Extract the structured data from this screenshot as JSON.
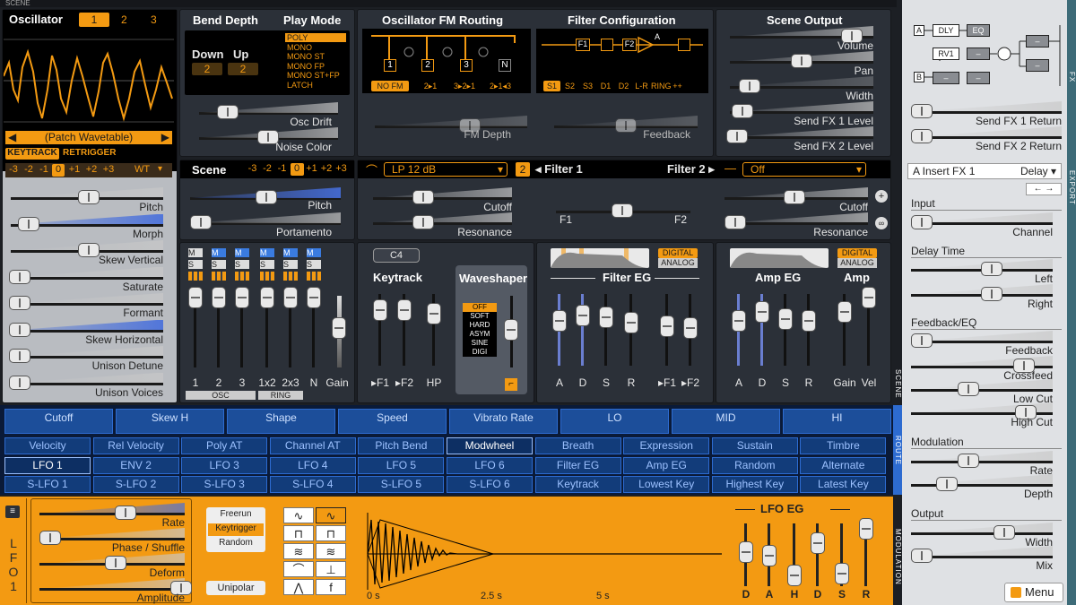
{
  "scene_tab": "SCENE",
  "osc": {
    "title": "Oscillator",
    "nums": [
      "1",
      "2",
      "3"
    ],
    "patch": "(Patch Wavetable)",
    "keytrack": "KEYTRACK",
    "retrigger": "RETRIGGER",
    "octaves": [
      "-3",
      "-2",
      "-1",
      "0",
      "+1",
      "+2",
      "+3"
    ],
    "wt": "WT",
    "sliders": [
      "Pitch",
      "Morph",
      "Skew Vertical",
      "Saturate",
      "Formant",
      "Skew Horizontal",
      "Unison Detune",
      "Unison Voices"
    ]
  },
  "bend": {
    "title": "Bend Depth",
    "down": "Down",
    "up": "Up",
    "down_val": "2",
    "up_val": "2",
    "osc_drift": "Osc Drift",
    "noise_color": "Noise Color"
  },
  "playmode": {
    "title": "Play Mode",
    "items": [
      "POLY",
      "MONO",
      "MONO ST",
      "MONO FP",
      "MONO ST+FP",
      "LATCH"
    ]
  },
  "fm": {
    "title": "Oscillator FM Routing",
    "boxes": [
      "1",
      "2",
      "3",
      "N"
    ],
    "buttons": [
      "NO FM",
      "2▸1",
      "3▸2▸1",
      "2▸1◂3"
    ],
    "fm_depth": "FM Depth"
  },
  "filtercfg": {
    "title": "Filter Configuration",
    "boxes": [
      "F1",
      "F2",
      "A"
    ],
    "buttons": [
      "S1",
      "S2",
      "S3",
      "D1",
      "D2",
      "L-R",
      "RING",
      "++"
    ],
    "feedback": "Feedback"
  },
  "sceneout": {
    "title": "Scene Output",
    "sliders": [
      "Volume",
      "Pan",
      "Width",
      "Send FX 1 Level",
      "Send FX 2 Level"
    ]
  },
  "scene": {
    "title": "Scene",
    "octaves": [
      "-3",
      "-2",
      "-1",
      "0",
      "+1",
      "+2",
      "+3"
    ],
    "pitch": "Pitch",
    "portamento": "Portamento"
  },
  "filters": {
    "f1_type": "LP 12 dB",
    "num": "2",
    "filter1": "◂ Filter 1",
    "filter2": "Filter 2 ▸",
    "f2_type": "Off",
    "cutoff": "Cutoff",
    "resonance": "Resonance",
    "f1": "F1",
    "f2": "F2"
  },
  "mixer": {
    "ms": [
      "M",
      "S"
    ],
    "labels": [
      "1",
      "2",
      "3",
      "1x2",
      "2x3",
      "N",
      "Gain"
    ],
    "osc": "OSC",
    "ring": "RING"
  },
  "keytrack": {
    "note": "C4",
    "title": "Keytrack",
    "labels": [
      "▸F1",
      "▸F2",
      "HP"
    ]
  },
  "waveshaper": {
    "title": "Waveshaper",
    "items": [
      "OFF",
      "SOFT",
      "HARD",
      "ASYM",
      "SINE",
      "DIGI"
    ]
  },
  "filtereg": {
    "title": "Filter EG",
    "digital": "DIGITAL",
    "analog": "ANALOG",
    "labels": [
      "A",
      "D",
      "S",
      "R",
      "▸F1",
      "▸F2"
    ]
  },
  "ampeg": {
    "title": "Amp EG",
    "amp": "Amp",
    "digital": "DIGITAL",
    "analog": "ANALOG",
    "labels": [
      "A",
      "D",
      "S",
      "R",
      "Gain",
      "Vel"
    ]
  },
  "macros": [
    "Cutoff",
    "Skew H",
    "Shape",
    "Speed",
    "Vibrato Rate",
    "LO",
    "MID",
    "HI"
  ],
  "route_row1": [
    "Velocity",
    "Rel Velocity",
    "Poly AT",
    "Channel AT",
    "Pitch Bend",
    "Modwheel",
    "Breath",
    "Expression",
    "Sustain",
    "Timbre"
  ],
  "route_row2": [
    "LFO 1",
    "ENV 2",
    "LFO 3",
    "LFO 4",
    "LFO 5",
    "LFO 6",
    "Filter EG",
    "Amp EG",
    "Random",
    "Alternate"
  ],
  "route_row3": [
    "S-LFO 1",
    "S-LFO 2",
    "S-LFO 3",
    "S-LFO 4",
    "S-LFO 5",
    "S-LFO 6",
    "Keytrack",
    "Lowest Key",
    "Highest Key",
    "Latest Key"
  ],
  "route_tab": "ROUTE",
  "lfo": {
    "vertical": "LFO 1",
    "sliders": [
      "Rate",
      "Phase / Shuffle",
      "Deform",
      "Amplitude"
    ],
    "trig": [
      "Freerun",
      "Keytrigger",
      "Random"
    ],
    "unipolar": "Unipolar",
    "time": [
      "0 s",
      "2.5 s",
      "5 s"
    ],
    "eg_title": "LFO EG",
    "eg_labels": [
      "D",
      "A",
      "H",
      "D",
      "S",
      "R"
    ]
  },
  "modulation_tab": "MODULATION",
  "fx": {
    "blocks": [
      "A",
      "B",
      "DLY",
      "EQ",
      "RV1"
    ],
    "send1": "Send FX 1 Return",
    "send2": "Send FX 2 Return",
    "slot": "A Insert FX 1",
    "type": "Delay ▾",
    "arrows": "◆ ◆",
    "sections": [
      "Input",
      "Delay Time",
      "Feedback/EQ",
      "Modulation",
      "Output"
    ],
    "params": [
      "Channel",
      "Left",
      "Right",
      "Feedback",
      "Crossfeed",
      "Low Cut",
      "High Cut",
      "Rate",
      "Depth",
      "Width",
      "Mix"
    ],
    "menu": "Menu",
    "tab": "FX",
    "tab2": "EXPORT"
  },
  "colors": {
    "orange": "#f39a12",
    "blue": "#2d6bd0",
    "panel": "#2b3038"
  }
}
